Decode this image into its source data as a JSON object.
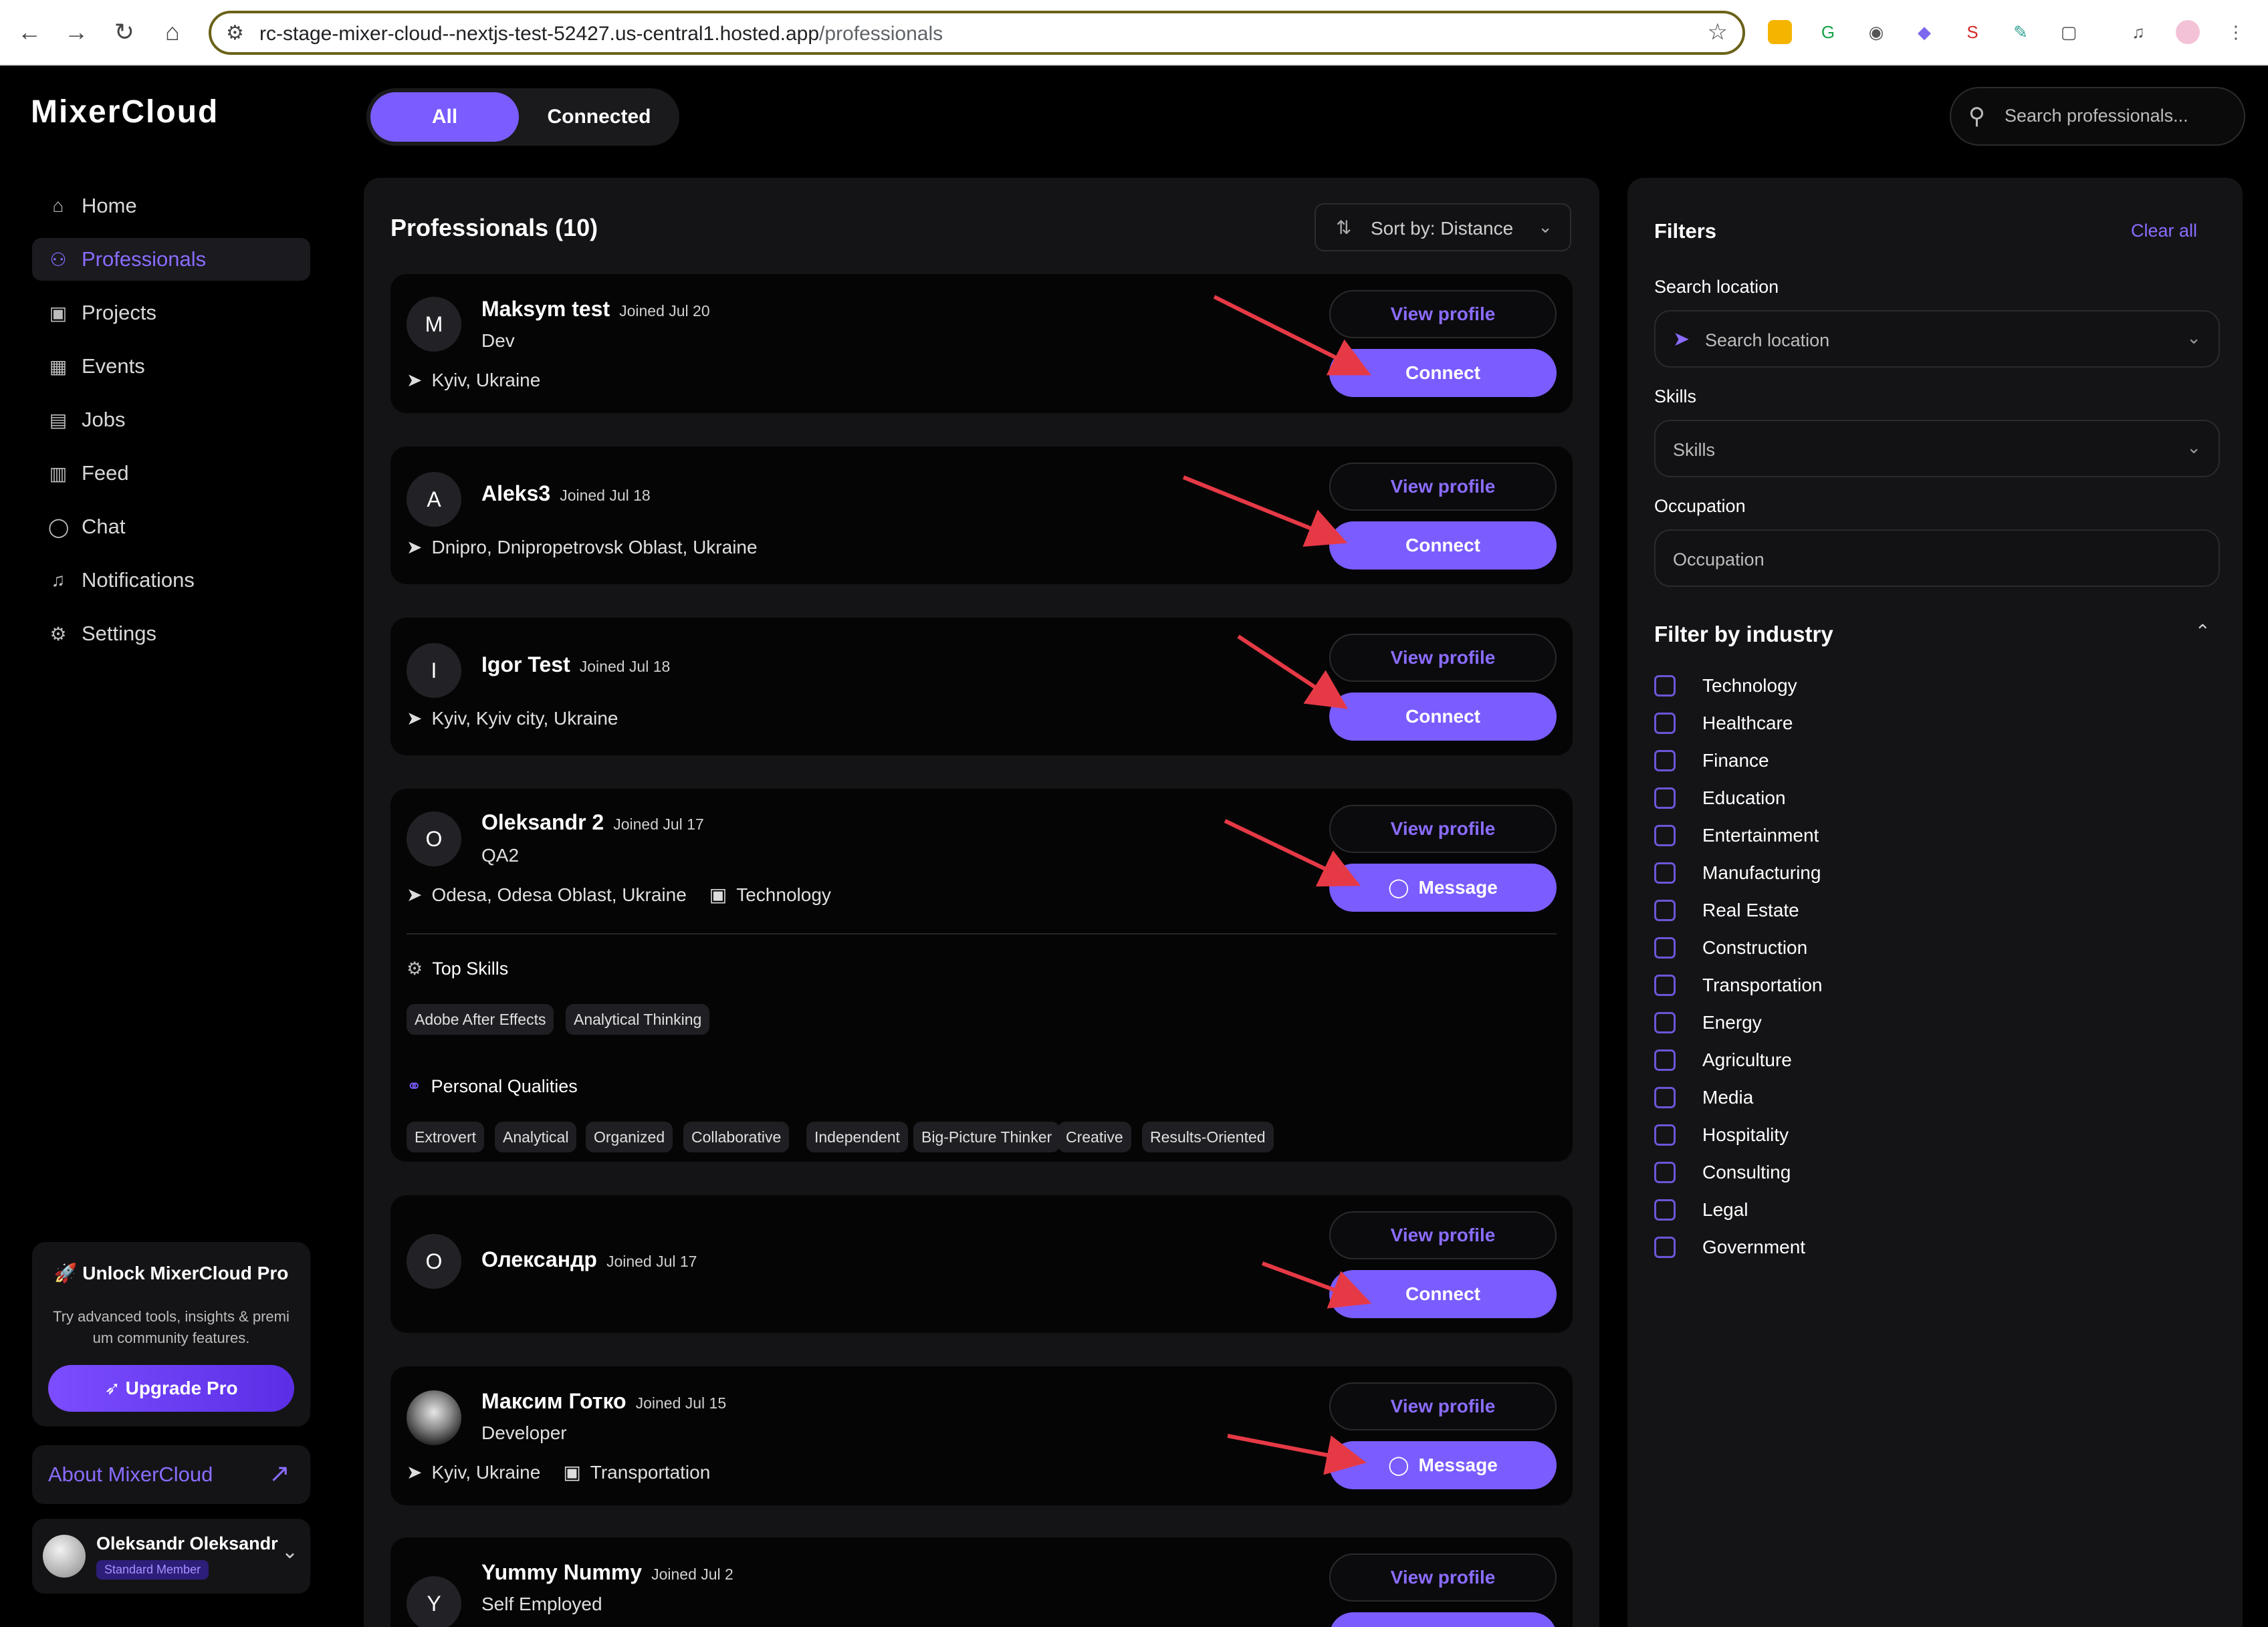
{
  "browser": {
    "url_host": "rc-stage-mixer-cloud--nextjs-test-52427.us-central1.hosted.app",
    "url_path": "/professionals"
  },
  "sidebar": {
    "logo": "MixerCloud",
    "items": [
      {
        "label": "Home",
        "icon": "home-icon"
      },
      {
        "label": "Professionals",
        "icon": "users-icon"
      },
      {
        "label": "Projects",
        "icon": "briefcase-icon"
      },
      {
        "label": "Events",
        "icon": "calendar-icon"
      },
      {
        "label": "Jobs",
        "icon": "suitcase-icon"
      },
      {
        "label": "Feed",
        "icon": "feed-icon"
      },
      {
        "label": "Chat",
        "icon": "chat-icon"
      },
      {
        "label": "Notifications",
        "icon": "bell-icon"
      },
      {
        "label": "Settings",
        "icon": "gear-icon"
      }
    ],
    "active": "Professionals",
    "pro": {
      "title": "🚀 Unlock MixerCloud Pro",
      "desc": "Try advanced tools, insights & premi um community features.",
      "button": "Upgrade Pro"
    },
    "about": "About MixerCloud",
    "user": {
      "name": "Oleksandr Oleksandr",
      "badge": "Standard Member"
    }
  },
  "tabs": {
    "all": "All",
    "connected": "Connected",
    "active": "All"
  },
  "search": {
    "placeholder": "Search professionals..."
  },
  "list": {
    "title": "Professionals (10)",
    "sort_label": "Sort by: Distance",
    "view_label": "View profile",
    "cards": [
      {
        "initial": "M",
        "name": "Maksym test",
        "joined": "Joined Jul 20",
        "role": "Dev",
        "location": "Kyiv, Ukraine",
        "industry": "",
        "action": "Connect"
      },
      {
        "initial": "A",
        "name": "Aleks3",
        "joined": "Joined Jul 18",
        "role": "",
        "location": "Dnipro, Dnipropetrovsk Oblast, Ukraine",
        "industry": "",
        "action": "Connect"
      },
      {
        "initial": "I",
        "name": "Igor Test",
        "joined": "Joined Jul 18",
        "role": "",
        "location": "Kyiv, Kyiv city, Ukraine",
        "industry": "",
        "action": "Connect"
      },
      {
        "initial": "O",
        "name": "Oleksandr 2",
        "joined": "Joined Jul 17",
        "role": "QA2",
        "location": "Odesa, Odesa Oblast, Ukraine",
        "industry": "Technology",
        "action": "Message",
        "top_skills_label": "Top Skills",
        "skills": [
          "Adobe After Effects",
          "Analytical Thinking"
        ],
        "qualities_label": "Personal Qualities",
        "qualities": [
          "Extrovert",
          "Analytical",
          "Organized",
          "Collaborative",
          "Independent",
          "Big-Picture Thinker",
          "Creative",
          "Results-Oriented"
        ]
      },
      {
        "initial": "O",
        "name": "Олександр",
        "joined": "Joined Jul 17",
        "role": "",
        "location": "",
        "industry": "",
        "action": "Connect"
      },
      {
        "initial": "",
        "name": "Максим Готко",
        "joined": "Joined Jul 15",
        "role": "Developer",
        "location": "Kyiv, Ukraine",
        "industry": "Transportation",
        "action": "Message"
      },
      {
        "initial": "Y",
        "name": "Yummy Nummy",
        "joined": "Joined Jul 2",
        "role": "Self Employed",
        "location": "",
        "industry": "",
        "action": ""
      }
    ]
  },
  "filters": {
    "title": "Filters",
    "clear": "Clear all",
    "location_label": "Search location",
    "location_placeholder": "Search location",
    "skills_label": "Skills",
    "skills_placeholder": "Skills",
    "occupation_label": "Occupation",
    "occupation_placeholder": "Occupation",
    "industry_title": "Filter by industry",
    "industries": [
      "Technology",
      "Healthcare",
      "Finance",
      "Education",
      "Entertainment",
      "Manufacturing",
      "Real Estate",
      "Construction",
      "Transportation",
      "Energy",
      "Agriculture",
      "Media",
      "Hospitality",
      "Consulting",
      "Legal",
      "Government"
    ]
  },
  "colors": {
    "accent": "#7b5cff",
    "annotation": "#e63946"
  }
}
